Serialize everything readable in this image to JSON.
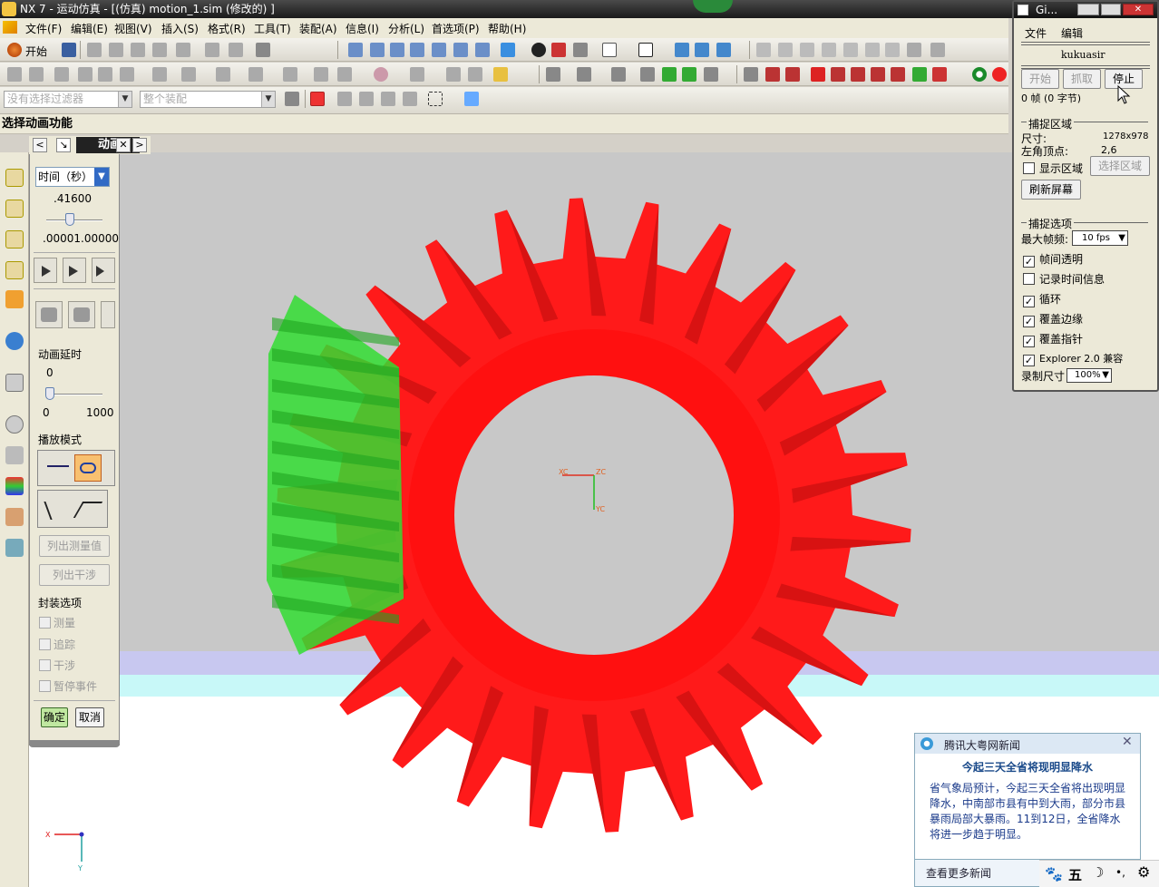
{
  "app": {
    "title": "NX 7 - 运动仿真 - [(仿真) motion_1.sim  (修改的) ]"
  },
  "menu": [
    "文件(F)",
    "编辑(E)",
    "视图(V)",
    "插入(S)",
    "格式(R)",
    "工具(T)",
    "装配(A)",
    "信息(I)",
    "分析(L)",
    "首选项(P)",
    "帮助(H)"
  ],
  "toolbar": {
    "start_label": "开始",
    "filter_placeholder": "没有选择过滤器",
    "assembly_scope": "整个装配"
  },
  "cue_line": "选择动画功能",
  "dialog": {
    "tab_label": "动画",
    "time_mode": "时间（秒）",
    "time_value": ".41600",
    "time_range_start": ".00001",
    "time_range_end": ".00000",
    "time_fraction": 0.416,
    "delay_label": "动画延时",
    "delay_value": "0",
    "delay_min": "0",
    "delay_max": "1000",
    "playback_label": "播放模式",
    "list_measure_button": "列出测量值",
    "list_interference_button": "列出干涉",
    "package_label": "封装选项",
    "package_options": [
      "测量",
      "追踪",
      "干涉",
      "暂停事件"
    ],
    "ok_button": "确定",
    "cancel_button": "取消"
  },
  "gif_tool": {
    "title": "Gi...",
    "menu": [
      "文件",
      "编辑"
    ],
    "user": "kukuasir",
    "start_button": "开始",
    "capture_button": "抓取",
    "stop_button": "停止",
    "frames_text": "0 帧 (0 字节)",
    "capture_area_label": "捕捉区域",
    "size_label": "尺寸:",
    "size_value": "1278x978",
    "corner_label": "左角顶点:",
    "corner_value": "2,6",
    "show_area_label": "显示区域",
    "select_area_button": "选择区域",
    "refresh_button": "刷新屏幕",
    "capture_options_label": "捕捉选项",
    "max_fps_label": "最大帧频:",
    "max_fps_value": "10 fps",
    "options": [
      {
        "label": "帧间透明",
        "checked": true
      },
      {
        "label": "记录时间信息",
        "checked": false
      },
      {
        "label": "循环",
        "checked": true
      },
      {
        "label": "覆盖边缘",
        "checked": true
      },
      {
        "label": "覆盖指针",
        "checked": true
      },
      {
        "label": "Explorer 2.0 兼容",
        "checked": true
      }
    ],
    "record_size_label": "录制尺寸",
    "record_size_value": "100%"
  },
  "viewport": {
    "axis_labels": {
      "xc": "XC",
      "zc": "ZC",
      "yc": "YC",
      "x": "X",
      "y": "Y"
    },
    "gear_color": "#ff1a1a",
    "pinion_color": "#33dd33"
  },
  "news": {
    "source": "腾讯大粤网新闻",
    "headline": "今起三天全省将现明显降水",
    "body": "省气象局预计，今起三天全省将出现明显降水，中南部市县有中到大雨，部分市县暴雨局部大暴雨。11到12日，全省降水将进一步趋于明显。",
    "more_link": "查看更多新闻"
  },
  "tray": {
    "ime": "五"
  }
}
